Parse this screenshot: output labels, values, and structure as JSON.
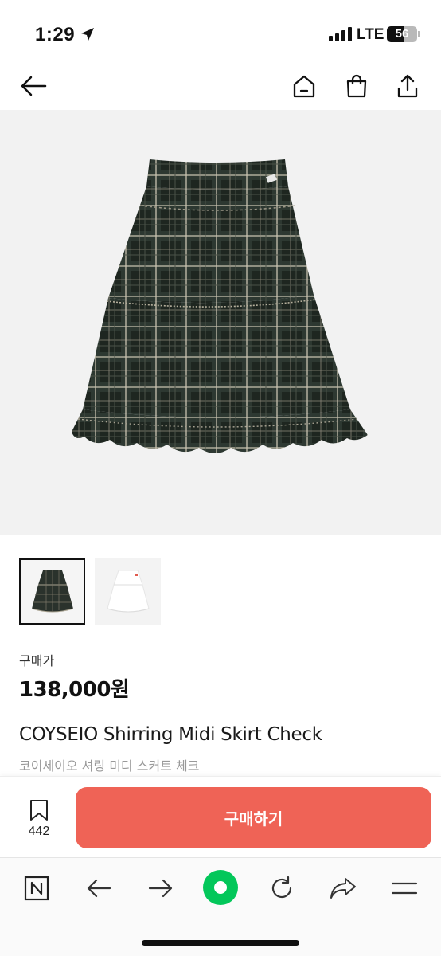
{
  "status_bar": {
    "time": "1:29",
    "network": "LTE",
    "battery": "56",
    "battery_level": 0.56
  },
  "header": {
    "icons": [
      "back-arrow-icon",
      "home-icon",
      "shopping-bag-icon",
      "share-icon"
    ]
  },
  "product": {
    "thumbnails": [
      "skirt-check-dark",
      "skirt-white"
    ],
    "price_label": "구매가",
    "price": "138,000원",
    "title_en": "COYSEIO Shirring Midi Skirt Check",
    "title_ko": "코이세이오 셔링 미디 스커트 체크"
  },
  "action_bar": {
    "wish_count": "442",
    "buy_label": "구매하기",
    "buy_color": "#ef6356"
  },
  "browser_toolbar": {
    "icons": [
      "naver-n-icon",
      "back-icon",
      "forward-icon",
      "green-dot-icon",
      "reload-icon",
      "share-arrow-icon",
      "menu-icon"
    ],
    "accent": "#03c75a"
  }
}
